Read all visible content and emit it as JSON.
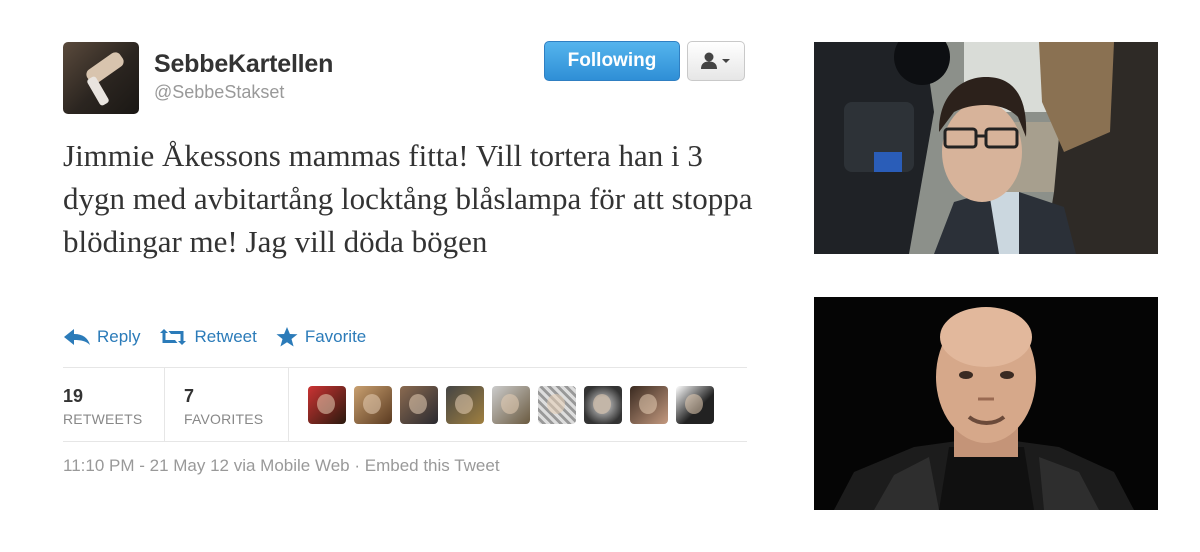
{
  "tweet": {
    "display_name": "SebbeKartellen",
    "handle": "@SebbeStakset",
    "follow_label": "Following",
    "text": "Jimmie Åkessons mammas fitta! Vill tortera han i 3 dygn med avbitartång locktång blåslampa för att stoppa blödingar me! Jag vill döda bögen",
    "actions": {
      "reply": "Reply",
      "retweet": "Retweet",
      "favorite": "Favorite"
    },
    "stats": {
      "retweets_count": "19",
      "retweets_label": "RETWEETS",
      "favorites_count": "7",
      "favorites_label": "FAVORITES"
    },
    "meta": {
      "time": "11:10 PM - 21 May 12 via Mobile Web",
      "separator": " · ",
      "embed": "Embed this Tweet"
    }
  },
  "colors": {
    "link": "#2b7bb9",
    "follow_button": "#3f9fe2",
    "muted_text": "#999999"
  },
  "icons": [
    "user-dropdown-icon",
    "reply-icon",
    "retweet-icon",
    "star-icon"
  ]
}
